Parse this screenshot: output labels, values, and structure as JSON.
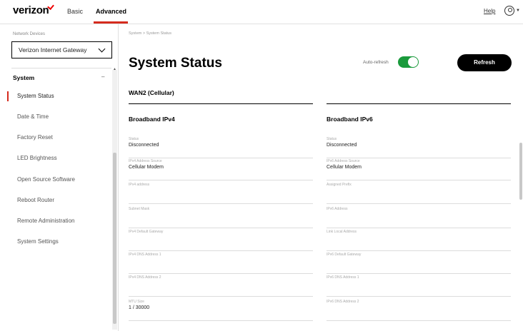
{
  "header": {
    "logo_text": "verizon",
    "tabs": [
      "Basic",
      "Advanced"
    ],
    "active_tab": "Advanced",
    "help_label": "Help",
    "accent_color": "#d52b1e"
  },
  "sidebar": {
    "device_label": "Network Devices",
    "device_selected": "Verizon Internet Gateway",
    "section_title": "System",
    "items": [
      {
        "label": "System Status",
        "active": true
      },
      {
        "label": "Date & Time"
      },
      {
        "label": "Factory Reset"
      },
      {
        "label": "LED Brightness"
      },
      {
        "label": "Open Source Software"
      },
      {
        "label": "Reboot Router"
      },
      {
        "label": "Remote Administration"
      },
      {
        "label": "System Settings"
      }
    ]
  },
  "main": {
    "breadcrumb": "System  >  System Status",
    "page_title": "System Status",
    "auto_refresh_label": "Auto-refresh",
    "auto_refresh_on": true,
    "refresh_label": "Refresh",
    "toggle_color": "#1a9a3c",
    "section_title": "WAN2 (Cellular)",
    "ipv4": {
      "title": "Broadband IPv4",
      "fields": [
        {
          "label": "Status",
          "value": "Disconnected"
        },
        {
          "label": "IPv4 Address Source",
          "value": "Cellular Modem"
        },
        {
          "label": "IPv4 address",
          "value": ""
        },
        {
          "label": "Subnet Mask",
          "value": ""
        },
        {
          "label": "IPv4 Default Gateway",
          "value": ""
        },
        {
          "label": "IPv4 DNS Address 1",
          "value": ""
        },
        {
          "label": "IPv4 DNS Address 2",
          "value": ""
        },
        {
          "label": "MTU Size",
          "value": "1 / 30000"
        }
      ]
    },
    "ipv6": {
      "title": "Broadband IPv6",
      "fields": [
        {
          "label": "Status",
          "value": "Disconnected"
        },
        {
          "label": "IPv6 Address Source",
          "value": "Cellular Modem"
        },
        {
          "label": "Assigned Prefix",
          "value": ""
        },
        {
          "label": "IPv6 Address",
          "value": ""
        },
        {
          "label": "Link Local Address",
          "value": ""
        },
        {
          "label": "IPv6 Default Gateway",
          "value": ""
        },
        {
          "label": "IPv6 DNS Address 1",
          "value": ""
        },
        {
          "label": "IPv6 DNS Address 2",
          "value": ""
        }
      ]
    }
  }
}
